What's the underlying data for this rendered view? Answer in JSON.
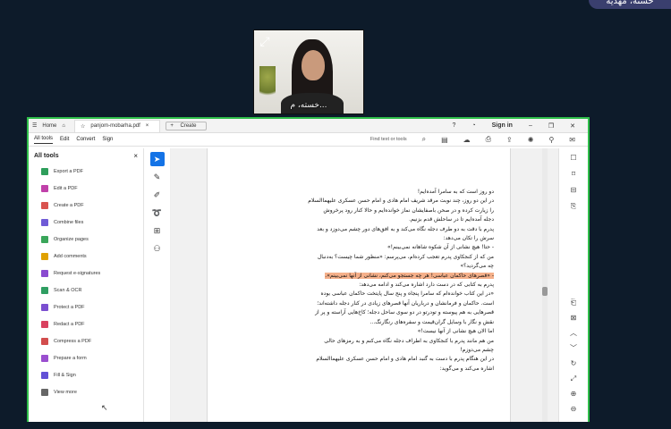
{
  "meeting": {
    "name_pill": "خسته، مهدیه",
    "camera_label": "خسته، م..."
  },
  "window": {
    "tabs": {
      "home": "Home",
      "file": "panjom-mobarha.pdf",
      "create": "Create"
    },
    "signin": "Sign in",
    "menu": [
      "All tools",
      "Edit",
      "Convert",
      "Sign"
    ],
    "find_placeholder": "Find text or tools"
  },
  "panel": {
    "title": "All tools",
    "tools": [
      {
        "label": "Export a PDF",
        "color": "#2e9e5b"
      },
      {
        "label": "Edit a PDF",
        "color": "#c041a9"
      },
      {
        "label": "Create a PDF",
        "color": "#d9534f"
      },
      {
        "label": "Combine files",
        "color": "#6f5bd6"
      },
      {
        "label": "Organize pages",
        "color": "#3aa65a"
      },
      {
        "label": "Add comments",
        "color": "#e0a100"
      },
      {
        "label": "Request e-signatures",
        "color": "#8a4bd0"
      },
      {
        "label": "Scan & OCR",
        "color": "#2f9e62"
      },
      {
        "label": "Protect a PDF",
        "color": "#7b4fd0"
      },
      {
        "label": "Redact a PDF",
        "color": "#d9415f"
      },
      {
        "label": "Compress a PDF",
        "color": "#d24d4d"
      },
      {
        "label": "Prepare a form",
        "color": "#9a4fcf"
      },
      {
        "label": "Fill & Sign",
        "color": "#6250d6"
      },
      {
        "label": "View more",
        "color": "#666666"
      }
    ]
  },
  "document": {
    "lines": [
      "دو روز است که به سامرا آمده‌ایم!",
      "در این دو روز، چند نوبت مرقد شریف امام هادی و امام حسن عسکری علیهما‌السلام",
      "را زیارت کرده و در صحن باصفایشان نماز خوانده‌ایم و حالا کنار رود پرخروش",
      "دجله آمده‌ایم تا در ساحلش قدم بزنیم.",
      "پدرم با دقت به دو طرف دجله نگاه می‌کند و به افق‌های دور چشم می‌دوزد و بعد",
      "سرش را تکان می‌دهد:",
      "- حتا! هیچ نشانی از آن شکوه شاهانه نمی‌بینم!»",
      "من که از کنجکاوی پدرم تعجب کرده‌ام، می‌پرسم: «منظور شما چیست؟ به‌دنبال",
      "چه می‌گردید؟»",
      "- «قصرهای حاکمان عباسی! هر چه جستجو می‌کنم، نشانی از آنها نمی‌بینم».",
      "پدرم به کتابی که در دست دارد اشاره می‌کند و ادامه می‌دهد:",
      "«در این کتاب خوانده‌ام که سامرا پنجاه و پنج سال پایتخت حاکمان عباسی بوده",
      "است. حاکمان و فرمانشان و درباریان آنها قصرهای زیادی در کنار دجله داشته‌اند؛",
      "قصرهایی به هم پیوسته و تو‌در‌تو در دو سوی ساحل دجله؛ کاخ‌هایی آراسته و پر از",
      "نقش و نگار با وسایل گران‌قیمت و سفره‌های رنگارنگ...",
      "اما الان هیچ نشانی از آنها نیست!»",
      "من هم مانند پدرم با کنجکاوی به اطراف دجله نگاه می‌کنم و به رمز‌های حالی",
      "چشم می‌دوزم!",
      "در این هنگام پدرم با دست به گنبد امام هادی و امام حسن عسکری علیهما‌السلام",
      "اشاره می‌کند و می‌گوید:"
    ]
  }
}
